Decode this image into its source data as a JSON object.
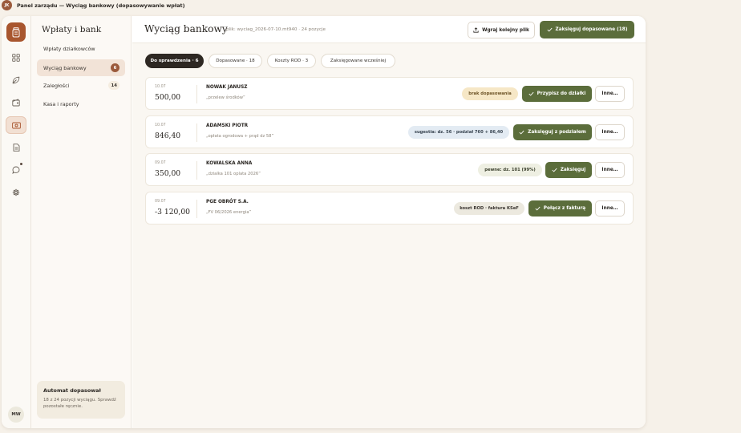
{
  "titlebar": {
    "badge": "JK",
    "title": "Panel zarządu — Wyciąg bankowy (dopasowywanie wpłat)"
  },
  "rail": {
    "avatar": "MW",
    "icons": [
      "grid-icon",
      "leaf-icon",
      "wallet-icon",
      "banknote-icon",
      "document-icon",
      "chat-icon",
      "gear-icon"
    ]
  },
  "sidebar": {
    "title": "Wpłaty i bank",
    "items": [
      {
        "label": "Wpłaty działkowców",
        "badge": ""
      },
      {
        "label": "Wyciąg bankowy",
        "badge": "6"
      },
      {
        "label": "Zaległości",
        "badge": "14"
      },
      {
        "label": "Kasa i raporty",
        "badge": ""
      }
    ],
    "automat": {
      "title": "Automat dopasował",
      "text": "18 z 24 pozycji wyciągu. Sprawdź pozostałe ręcznie."
    }
  },
  "header": {
    "title": "Wyciąg bankowy",
    "meta": "plik: wyciag_2026-07-10.mt940 · 24 pozycje",
    "upload_label": "Wgraj kolejny plik",
    "post_all_label": "Zaksięguj dopasowane (18)"
  },
  "tabs": [
    {
      "label": "Do sprawdzenia · 6"
    },
    {
      "label": "Dopasowane · 18"
    },
    {
      "label": "Koszty ROD · 3"
    },
    {
      "label": "Zaksięgowane wcześniej"
    }
  ],
  "transactions": [
    {
      "date": "10.07",
      "amount": "500,00",
      "name": "NOWAK JANUSZ",
      "description": "„przelew środków”",
      "tag": "brak dopasowania",
      "tag_style": "warn",
      "action": "Przypisz do działki",
      "more": "Inne…"
    },
    {
      "date": "10.07",
      "amount": "846,40",
      "name": "ADAMSKI PIOTR",
      "description": "„opłata ogrodowa + prąd dz 58”",
      "tag": "sugestia: dz. 56 · podział 760 + 86,40",
      "tag_style": "info",
      "action": "Zaksięguj z podziałem",
      "more": "Inne…"
    },
    {
      "date": "09.07",
      "amount": "350,00",
      "name": "KOWALSKA ANNA",
      "description": "„dzialka 101 oplata 2026”",
      "tag": "pewne: dz. 101 (99%)",
      "tag_style": "ok",
      "action": "Zaksięguj",
      "more": "Inne…"
    },
    {
      "date": "09.07",
      "amount": "-3 120,00",
      "name": "PGE OBRÓT S.A.",
      "description": "„FV 06/2026 energia”",
      "tag": "koszt ROD · faktura KSeF",
      "tag_style": "neutral",
      "action": "Połącz z fakturą",
      "more": "Inne…"
    }
  ],
  "colors": {
    "accent": "#5b6d3b",
    "brand": "#a8562f",
    "active_tab": "#2e2823"
  }
}
